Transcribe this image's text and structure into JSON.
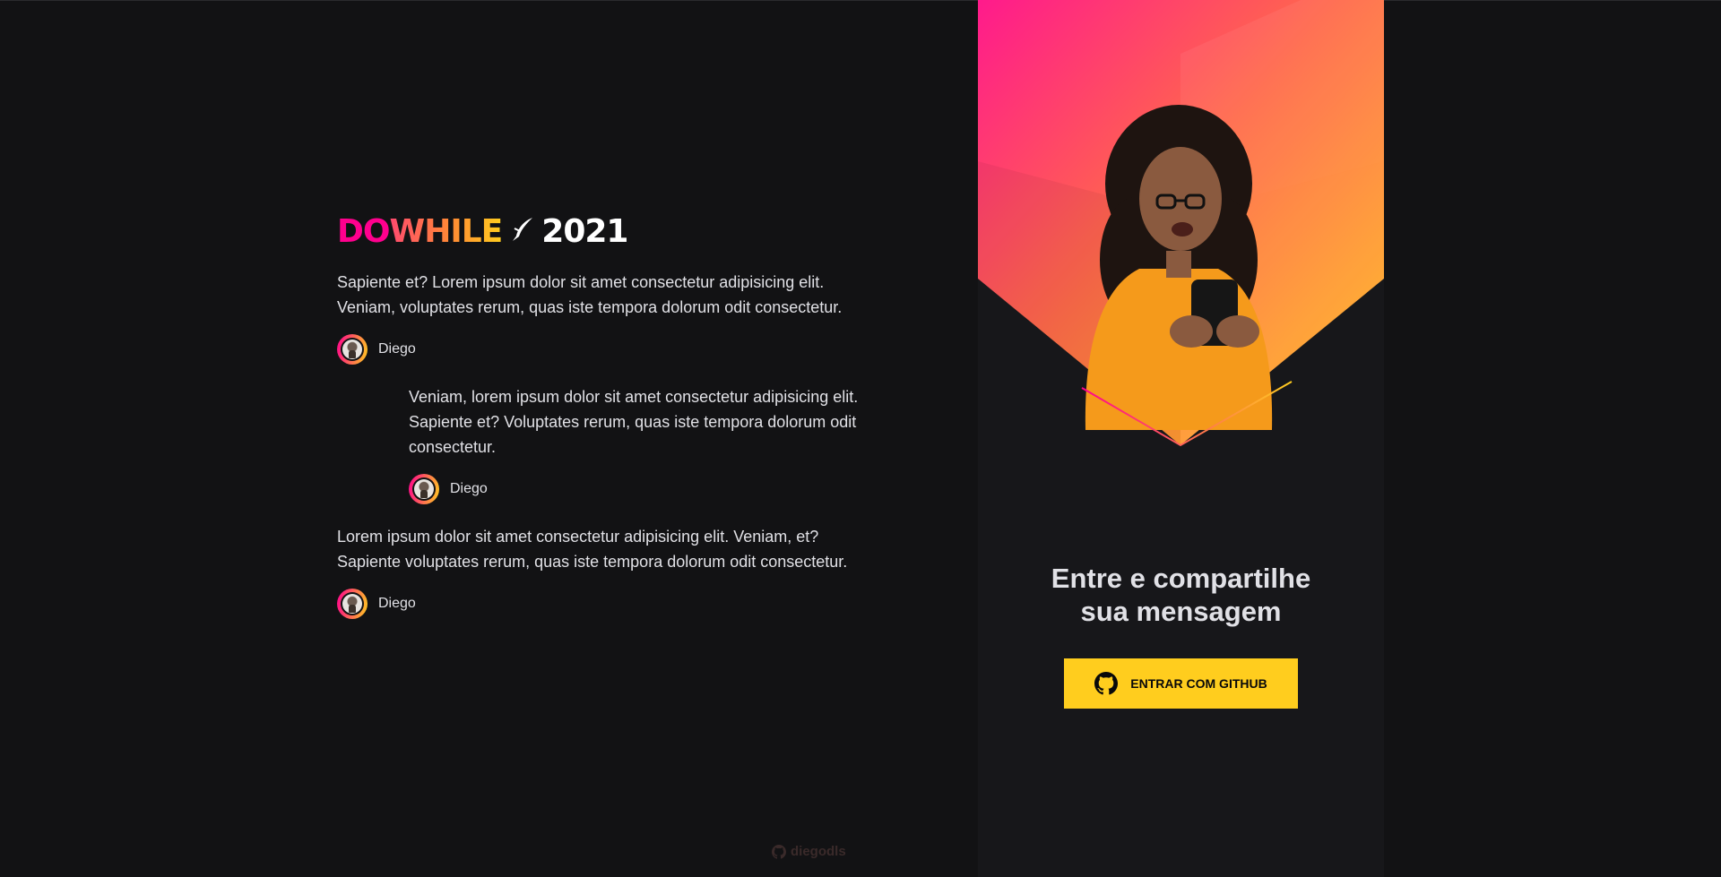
{
  "logo": {
    "do": "DO",
    "while": "WHILE",
    "year": "2021"
  },
  "messages": [
    {
      "text": "Sapiente et? Lorem ipsum dolor sit amet consectetur adipisicing elit. Veniam, voluptates rerum, quas iste tempora dolorum odit consectetur.",
      "user": "Diego"
    },
    {
      "text": "Veniam, lorem ipsum dolor sit amet consectetur adipisicing elit. Sapiente et? Voluptates rerum, quas iste tempora dolorum odit consectetur.",
      "user": "Diego"
    },
    {
      "text": "Lorem ipsum dolor sit amet consectetur adipisicing elit. Veniam, et? Sapiente voluptates rerum, quas iste tempora dolorum odit consectetur.",
      "user": "Diego"
    }
  ],
  "footer": {
    "github_user": "diegodls"
  },
  "login": {
    "title_line1": "Entre e compartilhe",
    "title_line2": "sua mensagem",
    "button_label": "ENTRAR COM GITHUB"
  },
  "icons": {
    "github": "github-icon",
    "quill": "quill-icon"
  },
  "colors": {
    "accent_yellow": "#FFCD1E",
    "accent_pink": "#FF008E",
    "background": "#121214",
    "panel": "#17171a"
  }
}
